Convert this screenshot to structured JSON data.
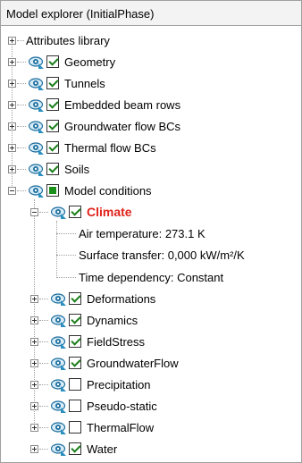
{
  "panel": {
    "title": "Model explorer (InitialPhase)"
  },
  "colors": {
    "active_label": "#e0231b",
    "checkbox_mark": "#1a7f1a",
    "eye_icon": "#1f6f9f"
  },
  "icons": {
    "visibility": "eye-icon",
    "expand": "plus-expander-icon",
    "collapse": "minus-expander-icon"
  },
  "tree": {
    "attributes_library": {
      "label": "Attributes library",
      "expanded": false
    },
    "geometry": {
      "label": "Geometry",
      "checked": true
    },
    "tunnels": {
      "label": "Tunnels",
      "checked": true
    },
    "embedded_beam_rows": {
      "label": "Embedded beam rows",
      "checked": true
    },
    "groundwater_flow_bcs": {
      "label": "Groundwater flow BCs",
      "checked": true
    },
    "thermal_flow_bcs": {
      "label": "Thermal flow BCs",
      "checked": true
    },
    "soils": {
      "label": "Soils",
      "checked": true
    },
    "model_conditions": {
      "label": "Model conditions",
      "state": "partial",
      "expanded": true,
      "climate": {
        "label": "Climate",
        "checked": true,
        "expanded": true,
        "properties": [
          {
            "text": "Air temperature: 273.1 K"
          },
          {
            "text": "Surface transfer: 0,000 kW/m²/K"
          },
          {
            "text": "Time dependency: Constant"
          }
        ]
      },
      "children": [
        {
          "label": "Deformations",
          "checked": true
        },
        {
          "label": "Dynamics",
          "checked": true
        },
        {
          "label": "FieldStress",
          "checked": true
        },
        {
          "label": "GroundwaterFlow",
          "checked": true
        },
        {
          "label": "Precipitation",
          "checked": false
        },
        {
          "label": "Pseudo-static",
          "checked": false
        },
        {
          "label": "ThermalFlow",
          "checked": false
        },
        {
          "label": "Water",
          "checked": true
        }
      ]
    }
  }
}
